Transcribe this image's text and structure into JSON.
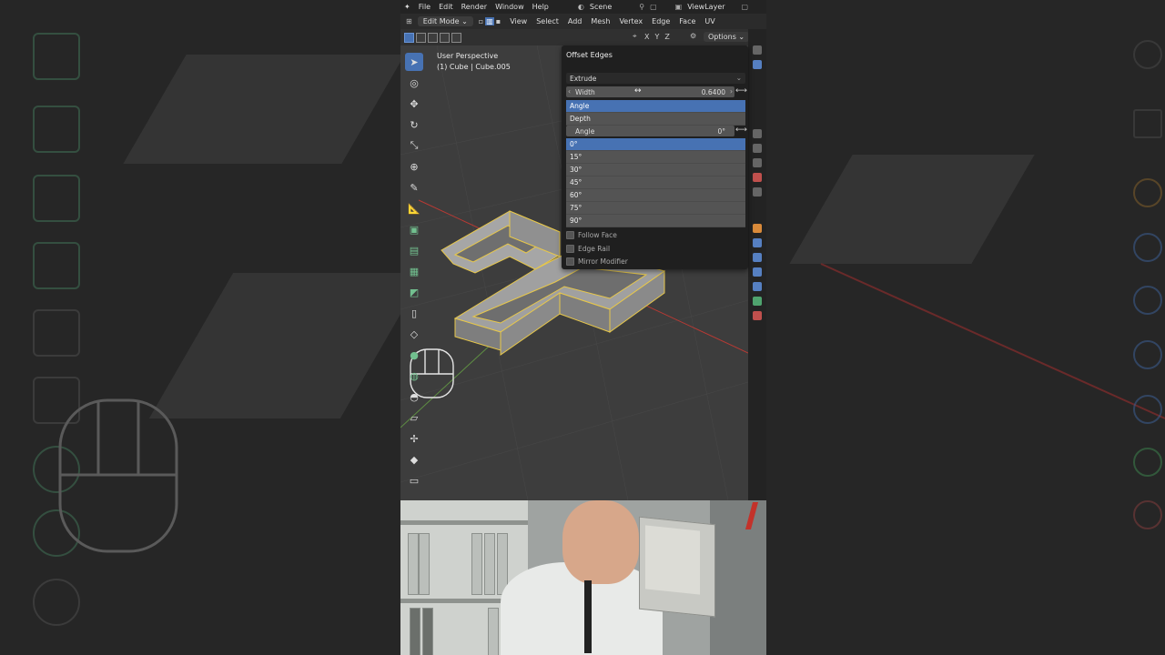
{
  "menu": {
    "items": [
      "File",
      "Edit",
      "Render",
      "Window",
      "Help"
    ],
    "scene": "Scene",
    "view_layer": "ViewLayer"
  },
  "header": {
    "mode": "Edit Mode",
    "items": [
      "View",
      "Select",
      "Add",
      "Mesh",
      "Vertex",
      "Edge",
      "Face",
      "UV"
    ]
  },
  "toolbar": {
    "axes": [
      "X",
      "Y",
      "Z"
    ],
    "options_label": "Options"
  },
  "viewport": {
    "perspective": "User Perspective",
    "object": "(1) Cube | Cube.005"
  },
  "operator_panel": {
    "title": "Offset Edges",
    "geometry_mode": "Extrude",
    "width_label": "Width",
    "width_value": "0.6400",
    "mode_options": [
      "Angle",
      "Depth"
    ],
    "mode_selected": "Angle",
    "angle_label": "Angle",
    "angle_value": "0°",
    "angle_presets": [
      "0°",
      "15°",
      "30°",
      "45°",
      "60°",
      "75°",
      "90°"
    ],
    "angle_preset_selected": "0°",
    "checkboxes": [
      {
        "label": "Follow Face",
        "checked": false
      },
      {
        "label": "Edge Rail",
        "checked": false
      },
      {
        "label": "Mirror Modifier",
        "checked": false
      }
    ]
  },
  "colors": {
    "selection_blue": "#4772b3",
    "edit_outline": "#e8c84a",
    "x_axis": "#c0392b",
    "y_axis": "#6aa84f"
  }
}
